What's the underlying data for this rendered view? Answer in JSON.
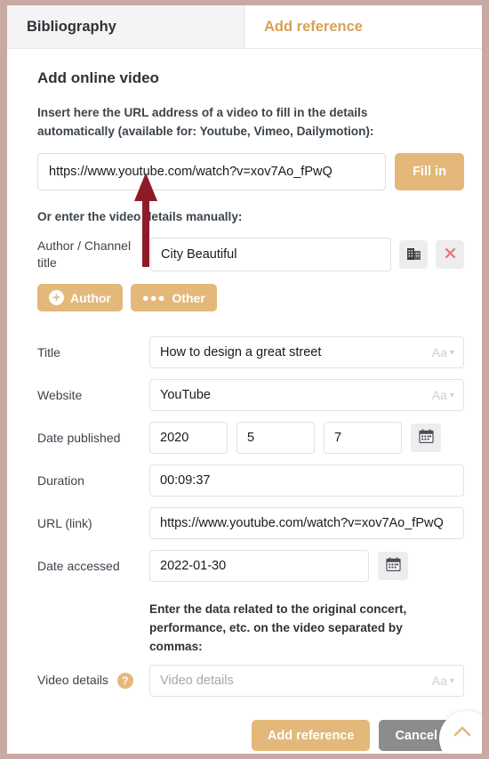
{
  "tabs": [
    {
      "label": "Bibliography",
      "active": false
    },
    {
      "label": "Add reference",
      "active": true
    }
  ],
  "form": {
    "section_title": "Add online video",
    "url_helper": "Insert here the URL address of a video to fill in the details automatically (available for: Youtube, Vimeo, Dailymotion):",
    "url_value": "https://www.youtube.com/watch?v=xov7Ao_fPwQ",
    "fill_in_label": "Fill in",
    "manual_label": "Or enter the video details manually:",
    "author_label": "Author / Channel title",
    "author_value": "City Beautiful",
    "pill_author": "Author",
    "pill_other": "Other",
    "title_label": "Title",
    "title_value": "How to design a great street",
    "website_label": "Website",
    "website_value": "YouTube",
    "date_published_label": "Date published",
    "date_year": "2020",
    "date_month": "5",
    "date_day": "7",
    "duration_label": "Duration",
    "duration_value": "00:09:37",
    "url_link_label": "URL (link)",
    "url_link_value": "https://www.youtube.com/watch?v=xov7Ao_fPwQ",
    "date_accessed_label": "Date accessed",
    "date_accessed_value": "2022-01-30",
    "video_note": "Enter the data related to the original concert, performance, etc. on the video separated by commas:",
    "video_details_label": "Video details",
    "video_details_placeholder": "Video details",
    "help_glyph": "?",
    "aa_glyph": "Aa"
  },
  "footer": {
    "submit_label": "Add reference",
    "cancel_label": "Cancel"
  },
  "colors": {
    "accent": "#e3b87a",
    "page_background": "#c9a9a3",
    "cancel_gray": "#8c8c8c",
    "annotation_red": "#8e1b29",
    "delete_red": "#e8736b"
  }
}
